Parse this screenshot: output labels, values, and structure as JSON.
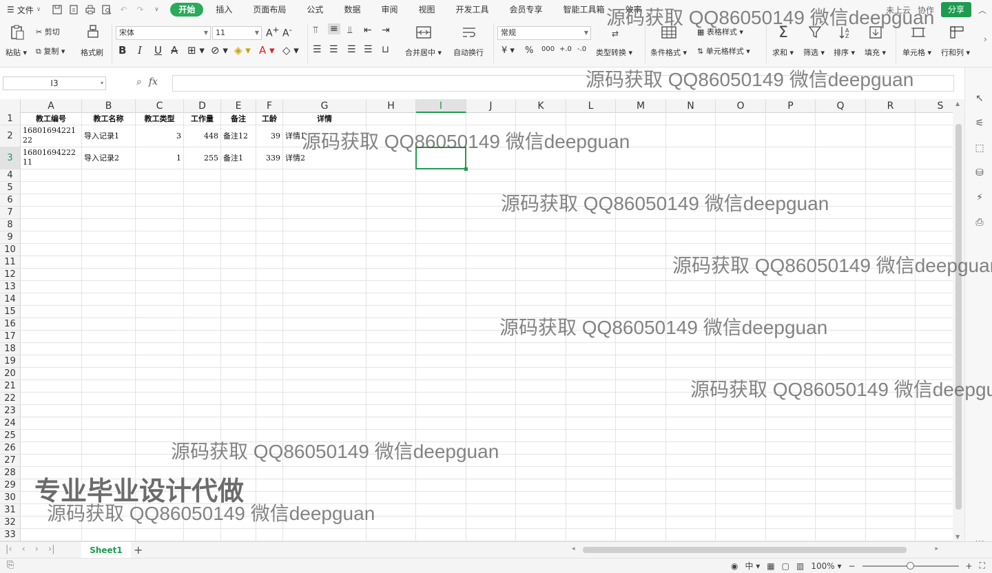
{
  "menubar": {
    "file_label": "文件",
    "tabs": [
      "开始",
      "插入",
      "页面布局",
      "公式",
      "数据",
      "审阅",
      "视图",
      "开发工具",
      "会员专享",
      "智能工具箱",
      "效率"
    ],
    "right_items": [
      "未上云",
      "协作"
    ],
    "share_label": "分享"
  },
  "ribbon": {
    "paste": "粘贴",
    "cut": "剪切",
    "copy": "复制",
    "format_painter": "格式刷",
    "font_name": "宋体",
    "font_size": "11",
    "merge_center": "合并居中",
    "wrap_text": "自动换行",
    "number_format": "常规",
    "type_convert": "类型转换",
    "cond_format": "条件格式",
    "table_style": "表格样式",
    "cell_style": "单元格样式",
    "sum": "求和",
    "filter": "筛选",
    "sort": "排序",
    "fill": "填充",
    "cell": "单元格",
    "row_col": "行和列"
  },
  "formula": {
    "name_box": "I3",
    "fx": "fx",
    "value": ""
  },
  "grid": {
    "columns": [
      "A",
      "B",
      "C",
      "D",
      "E",
      "F",
      "G",
      "H",
      "I",
      "J",
      "K",
      "L",
      "M",
      "N",
      "O",
      "P",
      "Q",
      "R",
      "S"
    ],
    "selected_col": "I",
    "selected_row": 3,
    "rows": [
      "1",
      "2",
      "3",
      "4",
      "5",
      "6",
      "7",
      "8",
      "9",
      "10",
      "11",
      "12",
      "13",
      "14",
      "15",
      "16",
      "17",
      "18",
      "19",
      "20",
      "21",
      "22",
      "23",
      "24",
      "25",
      "26",
      "27",
      "28",
      "29",
      "30",
      "31",
      "32",
      "33"
    ],
    "header": [
      "教工编号",
      "教工名称",
      "教工类型",
      "工作量",
      "备注",
      "工龄",
      "详情"
    ],
    "records": [
      [
        "1680169422122",
        "导入记录1",
        "3",
        "448",
        "备注12",
        "39",
        "详情1"
      ],
      [
        "1680169422211",
        "导入记录2",
        "1",
        "255",
        "备注1",
        "339",
        "详情2"
      ]
    ]
  },
  "sheets": {
    "tabs": [
      "Sheet1"
    ]
  },
  "status": {
    "zoom": "100%"
  },
  "watermarks": {
    "line": "源码获取 QQ86050149 微信deepguan",
    "big": "专业毕业设计代做"
  }
}
